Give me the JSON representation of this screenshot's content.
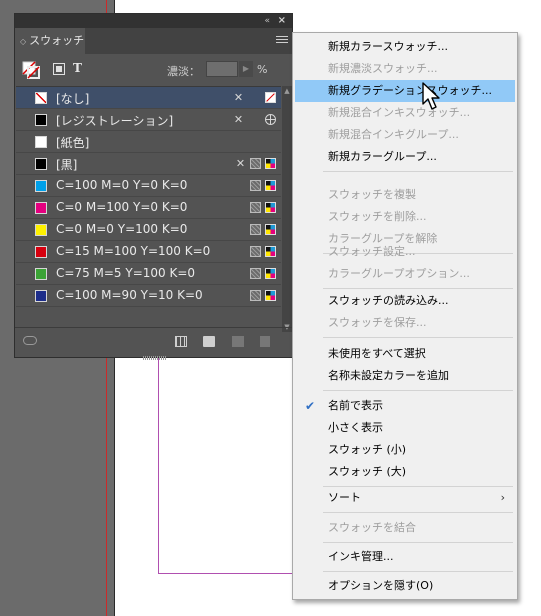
{
  "panel": {
    "tab_label": "スウォッチ",
    "tint_label": "濃淡：",
    "tint_unit": "%",
    "text_icon": "T",
    "swatches": [
      {
        "name": "[なし]",
        "color": "#ffffff",
        "type": "none",
        "selected": true
      },
      {
        "name": "[レジストレーション]",
        "color": "#000000",
        "type": "registration"
      },
      {
        "name": "[紙色]",
        "color": "#ffffff",
        "type": "paper"
      },
      {
        "name": "[黒]",
        "color": "#000000",
        "type": "black"
      },
      {
        "name": "C=100 M=0 Y=0 K=0",
        "color": "#00a0e9",
        "type": "process"
      },
      {
        "name": "C=0 M=100 Y=0 K=0",
        "color": "#e4007f",
        "type": "process"
      },
      {
        "name": "C=0 M=0 Y=100 K=0",
        "color": "#fff100",
        "type": "process"
      },
      {
        "name": "C=15 M=100 Y=100 K=0",
        "color": "#d7000f",
        "type": "process"
      },
      {
        "name": "C=75 M=5 Y=100 K=0",
        "color": "#3ba336",
        "type": "process"
      },
      {
        "name": "C=100 M=90 Y=10 K=0",
        "color": "#1d2d8a",
        "type": "process"
      }
    ]
  },
  "menu": {
    "items": [
      {
        "label": "新規カラースウォッチ...",
        "enabled": true
      },
      {
        "label": "新規濃淡スウォッチ...",
        "enabled": false
      },
      {
        "label": "新規グラデーションスウォッチ...",
        "enabled": true,
        "highlighted": true
      },
      {
        "label": "新規混合インキスウォッチ...",
        "enabled": false
      },
      {
        "label": "新規混合インキグループ...",
        "enabled": false
      },
      {
        "label": "新規カラーグループ...",
        "enabled": true
      },
      {
        "label": "スウォッチを複製",
        "enabled": false
      },
      {
        "label": "スウォッチを削除...",
        "enabled": false
      },
      {
        "label": "カラーグループを解除",
        "enabled": false
      },
      {
        "label": "スウォッチ設定...",
        "enabled": false
      },
      {
        "label": "カラーグループオプション...",
        "enabled": false
      },
      {
        "label": "スウォッチの読み込み...",
        "enabled": true
      },
      {
        "label": "スウォッチを保存...",
        "enabled": false
      },
      {
        "label": "未使用をすべて選択",
        "enabled": true
      },
      {
        "label": "名称未設定カラーを追加",
        "enabled": true
      },
      {
        "label": "名前で表示",
        "enabled": true,
        "checked": true
      },
      {
        "label": "小さく表示",
        "enabled": true
      },
      {
        "label": "スウォッチ (小)",
        "enabled": true
      },
      {
        "label": "スウォッチ (大)",
        "enabled": true
      },
      {
        "label": "ソート",
        "enabled": true,
        "submenu": true
      },
      {
        "label": "スウォッチを結合",
        "enabled": false
      },
      {
        "label": "インキ管理...",
        "enabled": true
      },
      {
        "label": "オプションを隠す(O)",
        "enabled": true
      }
    ],
    "check_mark": "✔",
    "submenu_arrow": "›"
  },
  "icons": {
    "collapse": "«",
    "close": "×",
    "tab_arrows": "◇",
    "no_edit": "✕",
    "scroll_up": "▲",
    "scroll_down": "▼",
    "tint_arrow": "▶"
  },
  "colors": {
    "highlight": "#91c9f7",
    "panel_bg": "#535353",
    "selected_row": "#3f4f69"
  }
}
